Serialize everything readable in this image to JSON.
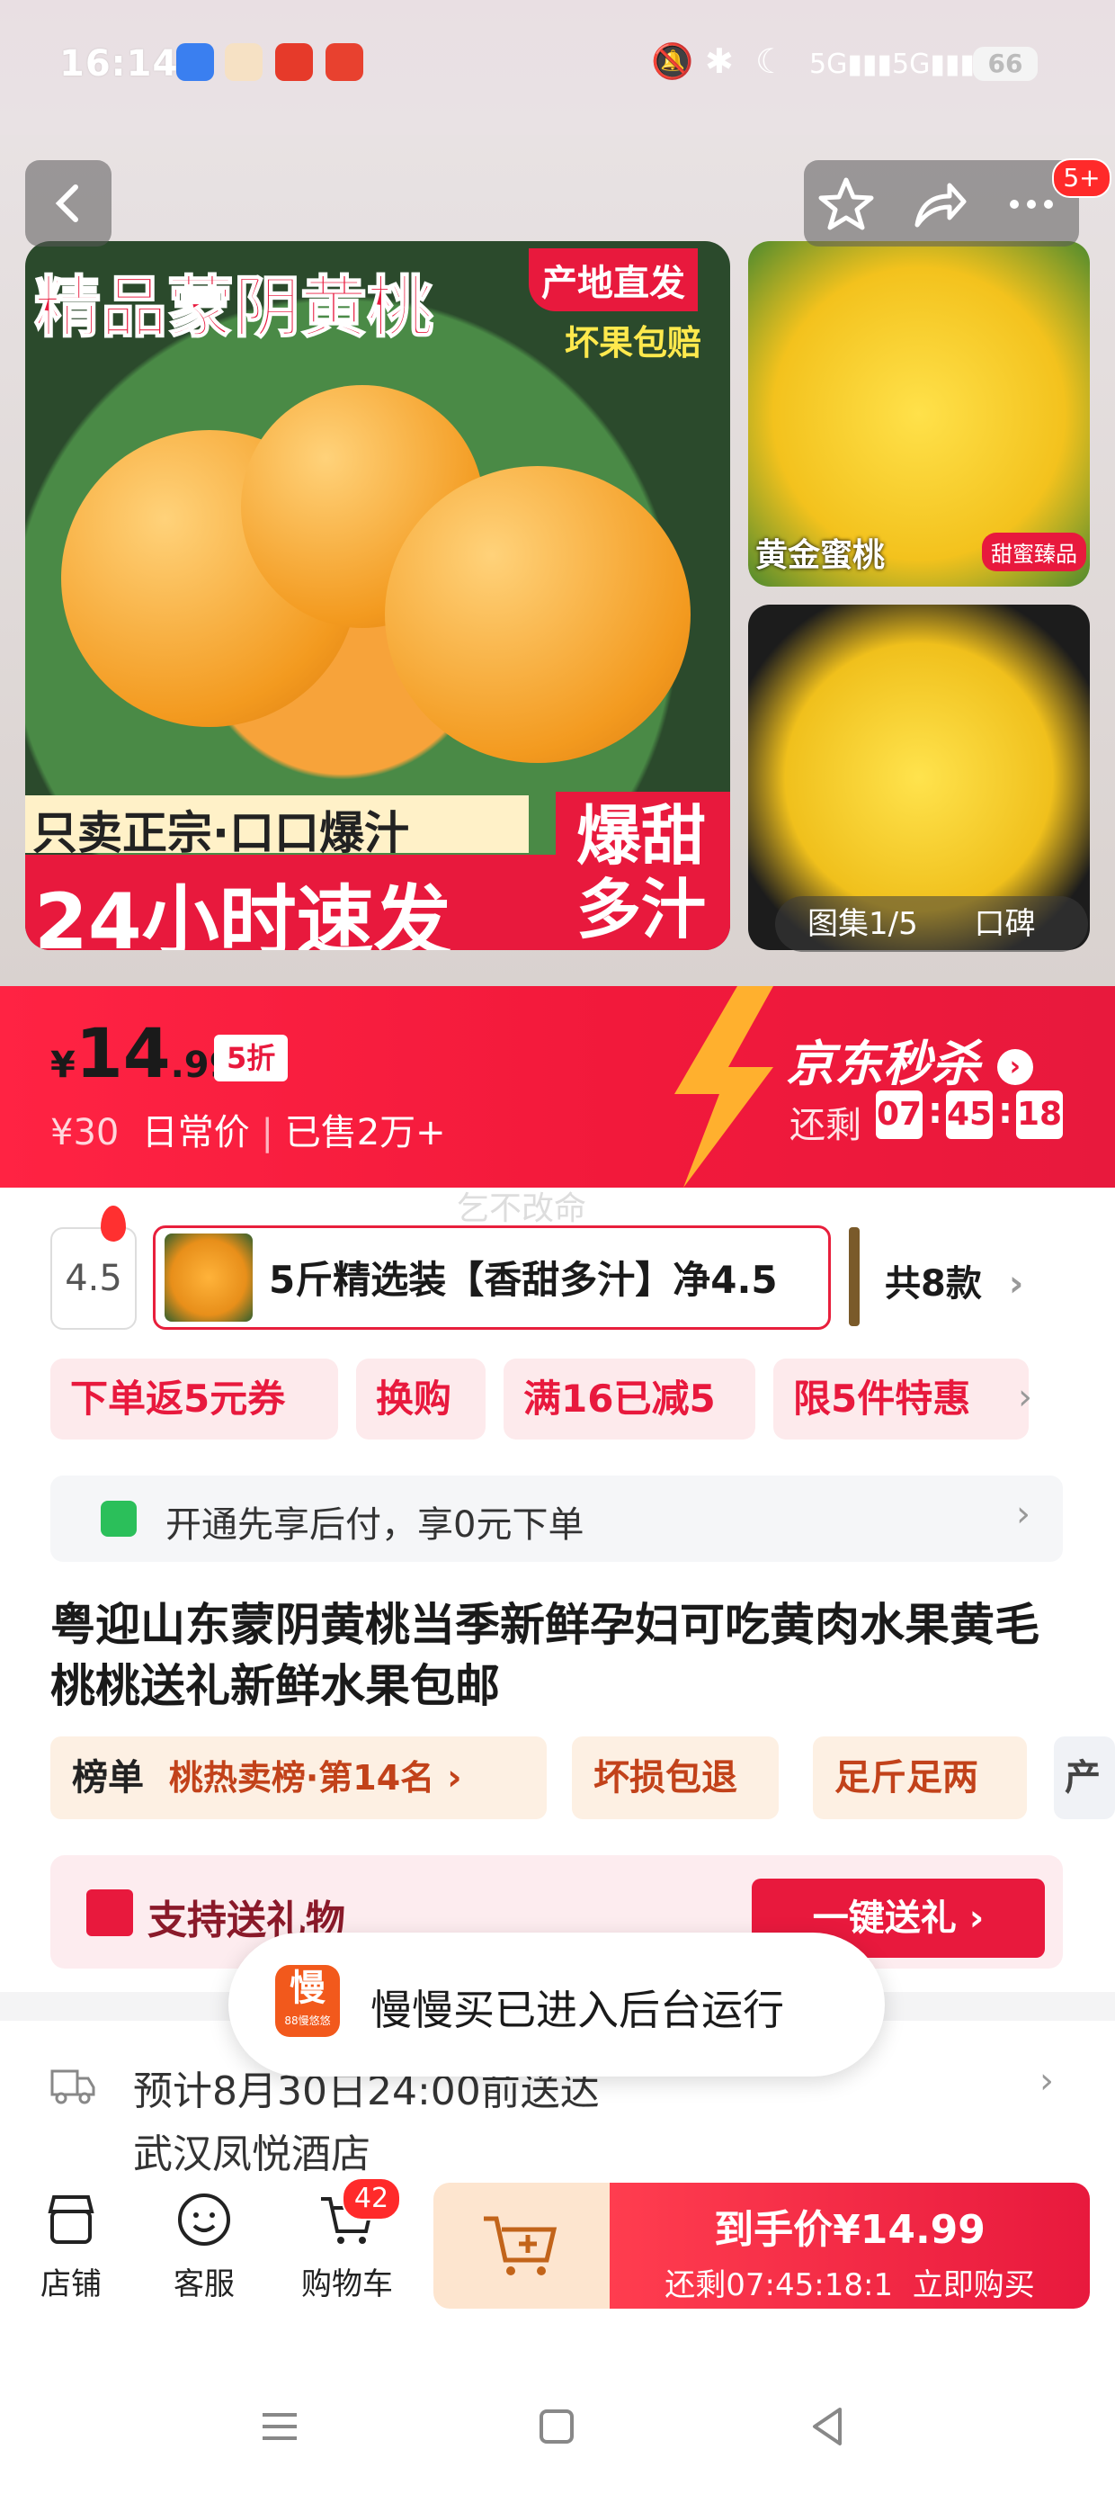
{
  "status_bar": {
    "time": "16:14",
    "battery": "66"
  },
  "gallery": {
    "main_headline": "精品蒙阴黄桃",
    "badge_origin": "产地直发",
    "badge_guarantee": "坏果包赔",
    "slogan_line1": "只卖正宗·口口爆汁",
    "slogan_line2": "24小时速发",
    "slogan_right": "爆甜多汁",
    "side1_label": "黄金蜜桃",
    "side1_badge": "甜蜜臻品",
    "counter": "图集1/5",
    "review_tab": "口碑",
    "more_badge": "5+"
  },
  "price": {
    "currency": "¥",
    "integer": "14",
    "decimal": ".99",
    "discount": "5折",
    "original": "¥30",
    "original_label": "日常价",
    "sold": "已售2万+",
    "flash_title": "京东秒杀",
    "remaining_label": "还剩",
    "hh": "07",
    "mm": "45",
    "ss": "18"
  },
  "watermark": "乞不改命",
  "variants": {
    "prev_stub": "4.5",
    "selected": "5斤精选装【香甜多汁】净4.5",
    "more": "共8款"
  },
  "promos": [
    "下单返5元券",
    "换购",
    "满16已减5",
    "限5件特惠"
  ],
  "paylater": {
    "text": "开通先享后付，享0元下单"
  },
  "title": "粤迎山东蒙阴黄桃当季新鲜孕妇可吃黄肉水果黄毛桃桃送礼新鲜水果包邮",
  "tags": {
    "rank_label": "榜单",
    "rank_value": "桃热卖榜·第14名",
    "t2": "坏损包退",
    "t3": "足斤足两",
    "t4": "产"
  },
  "gift": {
    "label": "支持送礼物",
    "button": "一键送礼"
  },
  "toast": {
    "icon_text": "慢",
    "icon_sub": "88慢悠悠",
    "text": "慢慢买已进入后台运行"
  },
  "delivery": {
    "text": "预计8月30日24:00前送达",
    "address": "武汉凤悦酒店"
  },
  "bottom": {
    "shop": "店铺",
    "service": "客服",
    "cart": "购物车",
    "cart_count": "42",
    "buy_label": "到手价¥14.99",
    "buy_sub": "还剩07:45:18:1",
    "buy_action": "立即购买"
  },
  "colors": {
    "brand_red": "#e8193d",
    "promo_bg": "#fdeaec"
  }
}
